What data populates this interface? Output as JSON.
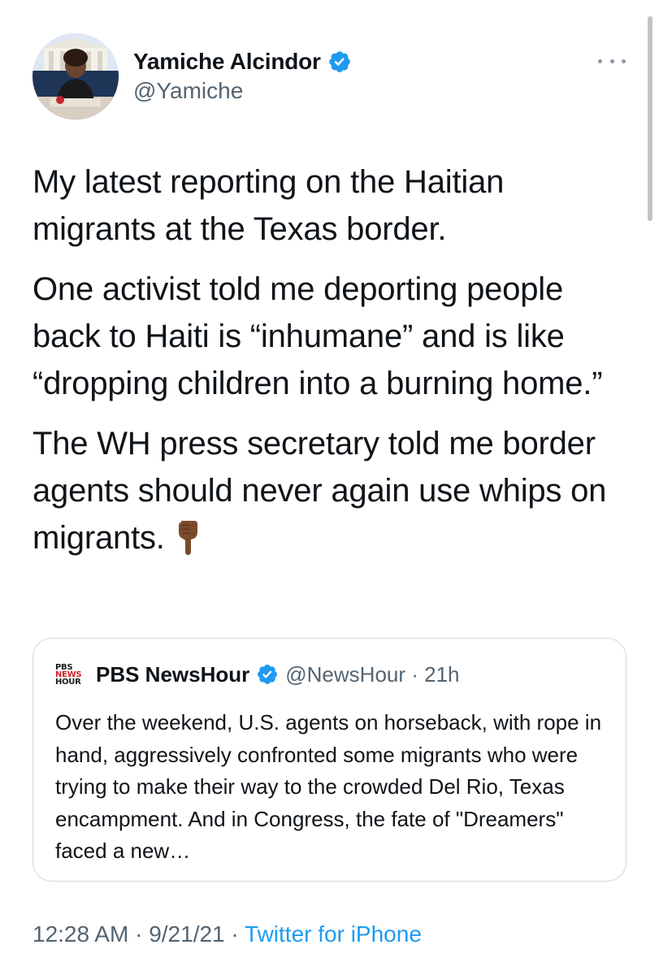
{
  "tweet": {
    "author": {
      "display_name": "Yamiche Alcindor",
      "handle": "@Yamiche",
      "verified": true,
      "avatar_icon": "profile-photo"
    },
    "paragraphs": [
      "My latest reporting on the Haitian migrants at the Texas border.",
      "One activist told me deporting people back to Haiti is “inhumane” and is like “dropping children into a burning home.”",
      "The WH press secretary told me border agents should never again use whips on migrants."
    ],
    "trailing_emoji": "backhand-index-pointing-down-medium-dark-skin-tone",
    "more_icon": "more-options-icon",
    "quoted": {
      "logo_lines": [
        "PBS",
        "NEWS",
        "HOUR"
      ],
      "display_name": "PBS NewsHour",
      "verified": true,
      "handle_time": "@NewsHour · 21h",
      "text": "Over the weekend, U.S. agents on horseback, with rope in hand, aggressively confronted some migrants who were trying to make their way to the crowded Del Rio, Texas encampment. And in Congress, the fate of \"Dreamers\" faced a new…"
    },
    "time": "12:28 AM",
    "date": "9/21/21",
    "separator": " · ",
    "source": "Twitter for iPhone"
  },
  "colors": {
    "verified_blue": "#1d9bf0",
    "secondary_text": "#536471",
    "card_border": "#cfd9de"
  }
}
